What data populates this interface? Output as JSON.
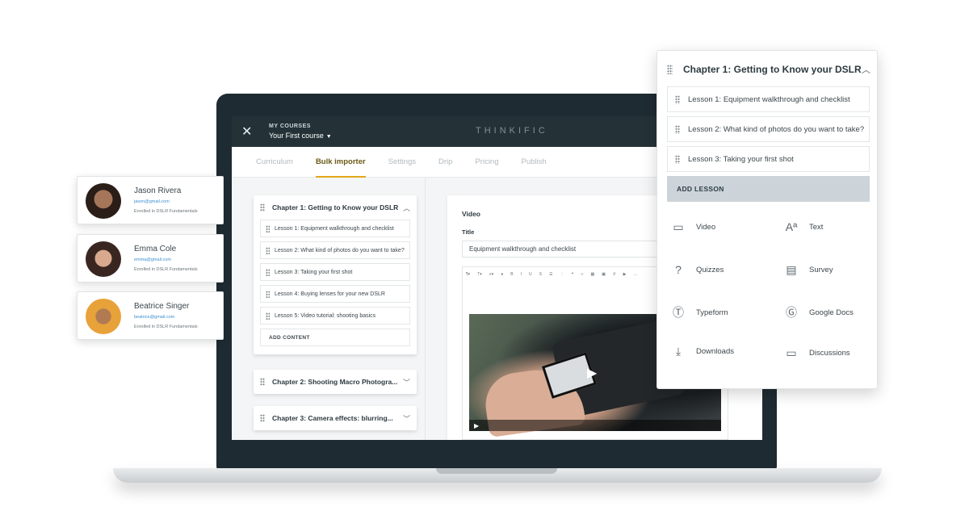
{
  "app": {
    "my_courses_label": "MY COURSES",
    "course_name": "Your First course",
    "brand": "THINKIFIC"
  },
  "tabs": [
    "Curriculum",
    "Bulk importer",
    "Settings",
    "Drip",
    "Pricing",
    "Publish"
  ],
  "curriculum": {
    "chapter1": {
      "title": "Chapter 1: Getting to Know your DSLR",
      "lessons": [
        "Lesson 1: Equipment walkthrough and checklist",
        "Lesson 2: What kind of photos do you want to take?",
        "Lesson 3: Taking your first shot",
        "Lesson 4: Buying lenses for your new DSLR",
        "Lesson 5: Video tutorial: shooting basics"
      ],
      "add_content": "ADD CONTENT"
    },
    "chapter2_title": "Chapter 2:  Shooting Macro Photogra...",
    "chapter3_title": "Chapter 3: Camera effects: blurring..."
  },
  "editor": {
    "section_label": "Video",
    "title_label": "Title",
    "title_value": "Equipment walkthrough and checklist"
  },
  "panel": {
    "title": "Chapter 1: Getting to Know your DSLR",
    "lessons": [
      "Lesson 1: Equipment walkthrough and checklist",
      "Lesson 2: What kind of photos do you want to take?",
      "Lesson 3: Taking your first shot"
    ],
    "add_lesson": "ADD LESSON",
    "content_types": [
      "Video",
      "Text",
      "Quizzes",
      "Survey",
      "Typeform",
      "Google Docs",
      "Downloads",
      "Discussions"
    ]
  },
  "students": [
    {
      "name": "Jason Rivera",
      "email": "jason@gmail.com",
      "enrolled": "Enrolled in DSLR Fundamentals"
    },
    {
      "name": "Emma Cole",
      "email": "emma@gmail.com",
      "enrolled": "Enrolled in DSLR Fundamentals"
    },
    {
      "name": "Beatrice Singer",
      "email": "beatrice@gmail.com",
      "enrolled": "Enrolled in DSLR Fundamentals"
    }
  ],
  "colors": {
    "topbar": "#243238",
    "active_tab_underline": "#e3a81a",
    "add_lesson_bg": "#ccd4da",
    "email_link": "#3d8fcf"
  }
}
